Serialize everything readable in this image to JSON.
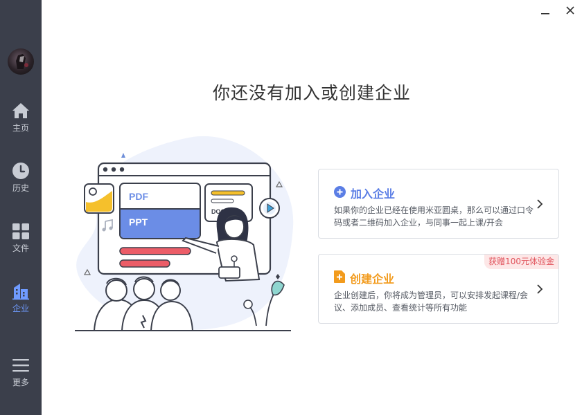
{
  "sidebar": {
    "items": [
      {
        "label": "主页",
        "icon": "home-icon"
      },
      {
        "label": "历史",
        "icon": "clock-icon"
      },
      {
        "label": "文件",
        "icon": "grid-icon"
      },
      {
        "label": "企业",
        "icon": "building-icon"
      },
      {
        "label": "更多",
        "icon": "menu-icon"
      }
    ],
    "active_index": 3
  },
  "window": {
    "minimize_icon": "minimize-icon",
    "close_icon": "close-icon"
  },
  "main": {
    "title": "你还没有加入或创建企业",
    "illustration": {
      "pdf_label": "PDF",
      "ppt_label": "PPT",
      "docs_label": "DOCS"
    },
    "cards": [
      {
        "title": "加入企业",
        "icon": "plus-circle-icon",
        "description": "如果你的企业已经在使用米亚圆桌，那么可以通过口令码或者二维码加入企业，与同事一起上课/开会"
      },
      {
        "title": "创建企业",
        "icon": "plus-square-icon",
        "badge": "获赠100元体验金",
        "description": "企业创建后，你将成为管理员，可以安排发起课程/会议、添加成员、查看统计等所有功能"
      }
    ]
  },
  "colors": {
    "sidebar_bg": "#3b3f4b",
    "accent_blue": "#6f9bff",
    "join_title": "#5b7ee5",
    "create_title": "#f29b1d",
    "badge_text": "#e0515a"
  }
}
